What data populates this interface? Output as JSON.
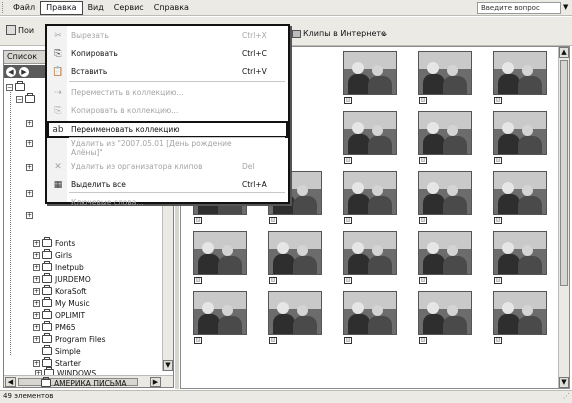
{
  "menubar": {
    "items": [
      "Файл",
      "Правка",
      "Вид",
      "Сервис",
      "Справка"
    ],
    "ask_placeholder": "Введите вопрос"
  },
  "toolbar": {
    "left_button": "Пои",
    "tabs": [
      "Клипы в Интернете"
    ]
  },
  "left_pane": {
    "header": "Список",
    "tree": [
      "Fonts",
      "Girls",
      "Inetpub",
      "JURDEMO",
      "KoraSoft",
      "My Music",
      "OPLIMIT",
      "PM65",
      "Program Files",
      "Simple",
      "Starter",
      "WINDOWS",
      "АМЕРИКА ПИСЬМА"
    ]
  },
  "dropdown": {
    "items": [
      {
        "label": "Вырезать",
        "shortcut": "Ctrl+X",
        "icon": "cut-icon",
        "enabled": false
      },
      {
        "label": "Копировать",
        "shortcut": "Ctrl+C",
        "icon": "copy-icon",
        "enabled": true
      },
      {
        "label": "Вставить",
        "shortcut": "Ctrl+V",
        "icon": "paste-icon",
        "enabled": true
      },
      {
        "label": "Переместить в коллекцию...",
        "shortcut": "",
        "icon": "move-icon",
        "enabled": false
      },
      {
        "label": "Копировать в коллекцию...",
        "shortcut": "",
        "icon": "copy-to-icon",
        "enabled": false
      },
      {
        "label": "Переименовать коллекцию",
        "shortcut": "",
        "icon": "rename-icon",
        "enabled": true
      },
      {
        "label": "Удалить из \"2007.05.01 [День рождение Алёны]\"",
        "shortcut": "",
        "icon": "",
        "enabled": false
      },
      {
        "label": "Удалить из организатора клипов",
        "shortcut": "Del",
        "icon": "delete-icon",
        "enabled": false
      },
      {
        "label": "Выделить все",
        "shortcut": "Ctrl+A",
        "icon": "select-all-icon",
        "enabled": true
      },
      {
        "label": "Ключевые слова...",
        "shortcut": "",
        "icon": "",
        "enabled": false
      }
    ]
  },
  "status": {
    "text": "49 элементов"
  }
}
